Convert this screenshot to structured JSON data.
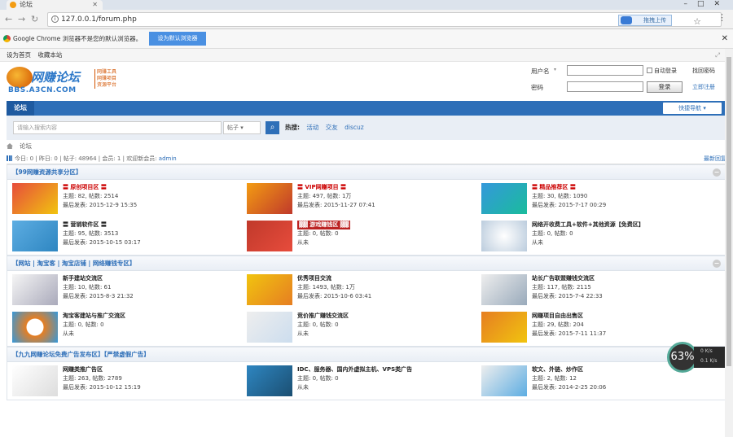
{
  "browser": {
    "tab_title": "论坛",
    "url": "127.0.0.1/forum.php",
    "upload_label": "拖拽上传"
  },
  "infobar": {
    "message": "Google Chrome 浏览器不是您的默认浏览器。",
    "button": "设为默认浏览器"
  },
  "topbar": {
    "set_home": "设为首页",
    "bookmark": "收藏本站"
  },
  "logo": {
    "name": "网赚论坛",
    "url": "BBS.A3CN.COM",
    "side": "网赚工具 网赚项目 资源平台"
  },
  "login": {
    "username_label": "用户名",
    "password_label": "密码",
    "remember": "自动登录",
    "forgot": "找回密码",
    "submit": "登录",
    "register": "立即注册"
  },
  "nav": {
    "current": "论坛",
    "quicknav": "快捷导航 ▾"
  },
  "search": {
    "placeholder": "请输入搜索内容",
    "scope": "帖子 ▾",
    "hot_label": "热搜:",
    "hot": [
      "活动",
      "交友",
      "discuz"
    ]
  },
  "crumb": {
    "label": "论坛"
  },
  "stats": {
    "text": "今日: 0 | 昨日: 0 | 帖子: 48964 | 会员: 1 | 欢迎新会员:",
    "newest_member": "admin",
    "latest": "最新回复"
  },
  "colors": {
    "accent": "#2e6fb8",
    "red": "#cc0000"
  },
  "sections": [
    {
      "title": "【99网赚资源共享分区】",
      "forums": [
        {
          "title": "〓 原创项目区 〓",
          "style": "red",
          "meta1": "主题: 82, 帖数: 2514",
          "meta2": "最后发表: 2015-12-9 15:35"
        },
        {
          "title": "〓 VIP网赚项目 〓",
          "style": "red",
          "meta1": "主题: 497, 帖数: 1万",
          "meta2": "最后发表: 2015-11-27 07:41"
        },
        {
          "title": "〓 精品推荐区 〓",
          "style": "red",
          "meta1": "主题: 30, 帖数: 1090",
          "meta2": "最后发表: 2015-7-17 00:29"
        },
        {
          "title": "〓 营销软件区 〓",
          "style": "normal",
          "meta1": "主题: 95, 帖数: 3513",
          "meta2": "最后发表: 2015-10-15 03:17"
        },
        {
          "title": "▓▓ 游戏赚钱区 ▓▓",
          "style": "banner",
          "meta1": "主题: 0, 帖数: 0",
          "meta2": "从未"
        },
        {
          "title": "网络开收费工具+软件+其他资源【免费区】",
          "style": "normal",
          "meta1": "主题: 0, 帖数: 0",
          "meta2": "从未"
        }
      ]
    },
    {
      "title": "【网站 | 淘宝客 | 淘宝店铺 | 网络赚钱专区】",
      "forums": [
        {
          "title": "新手建站交流区",
          "style": "normal",
          "meta1": "主题: 10, 帖数: 61",
          "meta2": "最后发表: 2015-8-3 21:32"
        },
        {
          "title": "优秀项目交流",
          "style": "normal",
          "meta1": "主题: 1493, 帖数: 1万",
          "meta2": "最后发表: 2015-10-6 03:41"
        },
        {
          "title": "站长广告联盟赚钱交流区",
          "style": "normal",
          "meta1": "主题: 117, 帖数: 2115",
          "meta2": "最后发表: 2015-7-4 22:33"
        },
        {
          "title": "淘宝客建站与推广交流区",
          "style": "normal",
          "meta1": "主题: 0, 帖数: 0",
          "meta2": "从未"
        },
        {
          "title": "竞价推广赚钱交流区",
          "style": "normal",
          "meta1": "主题: 0, 帖数: 0",
          "meta2": "从未"
        },
        {
          "title": "网赚项目自由出售区",
          "style": "normal",
          "meta1": "主题: 29, 帖数: 204",
          "meta2": "最后发表: 2015-7-11 11:37"
        }
      ]
    },
    {
      "title": "【九九网赚论坛免费广告发布区】【严禁虚假广告】",
      "forums": [
        {
          "title": "网赚类推广告区",
          "style": "normal",
          "meta1": "主题: 263, 帖数: 2789",
          "meta2": "最后发表: 2015-10-12 15:19"
        },
        {
          "title": "IDC、服务器、国内外虚拟主机、VPS类广告",
          "style": "normal",
          "meta1": "主题: 0, 帖数: 0",
          "meta2": "从未"
        },
        {
          "title": "软文、外链、炒作区",
          "style": "normal",
          "meta1": "主题: 2, 帖数: 12",
          "meta2": "最后发表: 2014-2-25 20:06"
        }
      ]
    }
  ],
  "widget": {
    "percent": "63%",
    "up": "0 K/s",
    "down": "0.1 K/s"
  }
}
